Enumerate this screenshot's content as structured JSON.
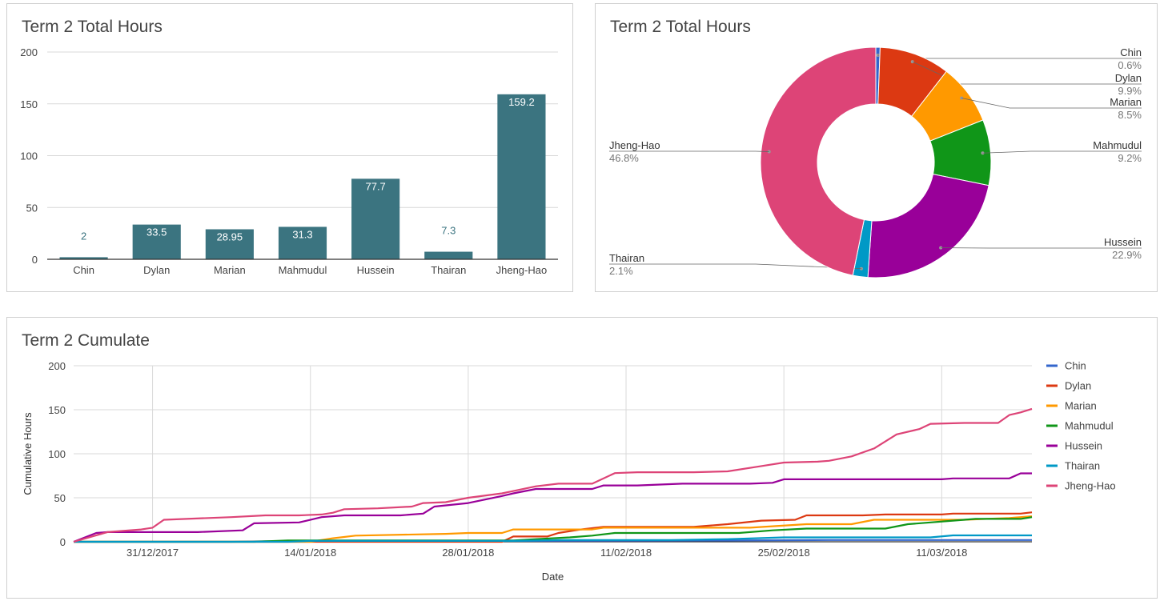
{
  "colors": {
    "bar": "#3b7480",
    "grid": "#d9d9d9",
    "axis": "#333333",
    "tick_text": "#444444",
    "pie_label": "#333333",
    "pie_pct": "#777777"
  },
  "bar_chart": {
    "title": "Term 2 Total Hours"
  },
  "pie_chart": {
    "title": "Term 2 Total Hours"
  },
  "line_chart": {
    "title": "Term 2 Cumulate"
  },
  "chart_data": [
    {
      "type": "bar",
      "title": "Term 2 Total Hours",
      "categories": [
        "Chin",
        "Dylan",
        "Marian",
        "Mahmudul",
        "Hussein",
        "Thairan",
        "Jheng-Hao"
      ],
      "values": [
        2,
        33.5,
        28.95,
        31.3,
        77.7,
        7.3,
        159.2
      ],
      "value_labels": [
        "2",
        "33.5",
        "28.95",
        "31.3",
        "77.7",
        "7.3",
        "159.2"
      ],
      "ylim": [
        0,
        200
      ],
      "yticks": [
        0,
        50,
        100,
        150,
        200
      ],
      "grid": true
    },
    {
      "type": "pie",
      "donut": true,
      "title": "Term 2 Total Hours",
      "slices": [
        {
          "label": "Chin",
          "percent": 0.6,
          "percent_text": "0.6%",
          "color": "#3366cc",
          "side": "right"
        },
        {
          "label": "Dylan",
          "percent": 9.9,
          "percent_text": "9.9%",
          "color": "#dc3912",
          "side": "right"
        },
        {
          "label": "Marian",
          "percent": 8.5,
          "percent_text": "8.5%",
          "color": "#ff9900",
          "side": "right"
        },
        {
          "label": "Mahmudul",
          "percent": 9.2,
          "percent_text": "9.2%",
          "color": "#109618",
          "side": "right"
        },
        {
          "label": "Hussein",
          "percent": 22.9,
          "percent_text": "22.9%",
          "color": "#990099",
          "side": "right"
        },
        {
          "label": "Thairan",
          "percent": 2.1,
          "percent_text": "2.1%",
          "color": "#0099c6",
          "side": "left"
        },
        {
          "label": "Jheng-Hao",
          "percent": 46.8,
          "percent_text": "46.8%",
          "color": "#dd4477",
          "side": "left"
        }
      ]
    },
    {
      "type": "line",
      "title": "Term 2 Cumulate",
      "xlabel": "Date",
      "ylabel": "Cumulative Hours",
      "x_start": "2017-12-24",
      "x_end": "2018-03-19",
      "x_ticks": [
        {
          "date": "2017-12-31",
          "label": "31/12/2017"
        },
        {
          "date": "2018-01-14",
          "label": "14/01/2018"
        },
        {
          "date": "2018-01-28",
          "label": "28/01/2018"
        },
        {
          "date": "2018-02-11",
          "label": "11/02/2018"
        },
        {
          "date": "2018-02-25",
          "label": "25/02/2018"
        },
        {
          "date": "2018-03-11",
          "label": "11/03/2018"
        }
      ],
      "ylim": [
        0,
        200
      ],
      "yticks": [
        0,
        50,
        100,
        150,
        200
      ],
      "grid": true,
      "legend_position": "right",
      "series": [
        {
          "name": "Chin",
          "color": "#3366cc",
          "points": [
            [
              "2017-12-24",
              0
            ],
            [
              "2018-01-07",
              0
            ],
            [
              "2018-01-10",
              0.5
            ],
            [
              "2018-02-01",
              1
            ],
            [
              "2018-02-20",
              1.5
            ],
            [
              "2018-03-01",
              2
            ],
            [
              "2018-03-19",
              2
            ]
          ]
        },
        {
          "name": "Dylan",
          "color": "#dc3912",
          "points": [
            [
              "2017-12-24",
              0
            ],
            [
              "2018-01-31",
              0
            ],
            [
              "2018-02-01",
              6
            ],
            [
              "2018-02-04",
              6
            ],
            [
              "2018-02-05",
              10
            ],
            [
              "2018-02-07",
              14
            ],
            [
              "2018-02-09",
              17
            ],
            [
              "2018-02-17",
              17
            ],
            [
              "2018-02-20",
              20
            ],
            [
              "2018-02-23",
              24
            ],
            [
              "2018-02-26",
              25
            ],
            [
              "2018-02-27",
              30
            ],
            [
              "2018-03-04",
              30
            ],
            [
              "2018-03-06",
              31
            ],
            [
              "2018-03-11",
              31
            ],
            [
              "2018-03-12",
              32
            ],
            [
              "2018-03-18",
              32
            ],
            [
              "2018-03-19",
              33.5
            ]
          ]
        },
        {
          "name": "Marian",
          "color": "#ff9900",
          "points": [
            [
              "2017-12-24",
              0
            ],
            [
              "2018-01-14",
              0
            ],
            [
              "2018-01-16",
              4
            ],
            [
              "2018-01-18",
              7
            ],
            [
              "2018-01-26",
              9
            ],
            [
              "2018-01-28",
              10
            ],
            [
              "2018-01-31",
              10
            ],
            [
              "2018-02-01",
              14
            ],
            [
              "2018-02-08",
              14
            ],
            [
              "2018-02-09",
              16
            ],
            [
              "2018-02-22",
              16
            ],
            [
              "2018-02-27",
              20
            ],
            [
              "2018-03-03",
              20
            ],
            [
              "2018-03-05",
              25
            ],
            [
              "2018-03-13",
              25
            ],
            [
              "2018-03-15",
              26
            ],
            [
              "2018-03-17",
              27
            ],
            [
              "2018-03-19",
              29
            ]
          ]
        },
        {
          "name": "Mahmudul",
          "color": "#109618",
          "points": [
            [
              "2017-12-24",
              0
            ],
            [
              "2018-01-09",
              0
            ],
            [
              "2018-01-12",
              1.5
            ],
            [
              "2018-02-01",
              1.5
            ],
            [
              "2018-02-03",
              3
            ],
            [
              "2018-02-06",
              5
            ],
            [
              "2018-02-08",
              7
            ],
            [
              "2018-02-10",
              10
            ],
            [
              "2018-02-21",
              10
            ],
            [
              "2018-02-24",
              13
            ],
            [
              "2018-02-27",
              15
            ],
            [
              "2018-03-06",
              15
            ],
            [
              "2018-03-08",
              20
            ],
            [
              "2018-03-10",
              22
            ],
            [
              "2018-03-12",
              24
            ],
            [
              "2018-03-14",
              26
            ],
            [
              "2018-03-18",
              26
            ],
            [
              "2018-03-19",
              28
            ]
          ]
        },
        {
          "name": "Hussein",
          "color": "#990099",
          "points": [
            [
              "2017-12-24",
              0
            ],
            [
              "2017-12-26",
              10
            ],
            [
              "2017-12-27",
              11
            ],
            [
              "2018-01-04",
              11
            ],
            [
              "2018-01-08",
              13
            ],
            [
              "2018-01-09",
              21
            ],
            [
              "2018-01-13",
              22
            ],
            [
              "2018-01-15",
              28
            ],
            [
              "2018-01-17",
              30
            ],
            [
              "2018-01-22",
              30
            ],
            [
              "2018-01-24",
              32
            ],
            [
              "2018-01-25",
              40
            ],
            [
              "2018-01-28",
              44
            ],
            [
              "2018-01-31",
              52
            ],
            [
              "2018-02-01",
              55
            ],
            [
              "2018-02-03",
              60
            ],
            [
              "2018-02-08",
              60
            ],
            [
              "2018-02-09",
              64
            ],
            [
              "2018-02-12",
              64
            ],
            [
              "2018-02-16",
              66
            ],
            [
              "2018-02-22",
              66
            ],
            [
              "2018-02-24",
              67
            ],
            [
              "2018-02-25",
              71
            ],
            [
              "2018-03-11",
              71
            ],
            [
              "2018-03-12",
              72
            ],
            [
              "2018-03-17",
              72
            ],
            [
              "2018-03-18",
              77.7
            ],
            [
              "2018-03-19",
              77.7
            ]
          ]
        },
        {
          "name": "Thairan",
          "color": "#0099c6",
          "points": [
            [
              "2017-12-24",
              0
            ],
            [
              "2018-01-12",
              0
            ],
            [
              "2018-01-14",
              1
            ],
            [
              "2018-02-01",
              1
            ],
            [
              "2018-02-05",
              2
            ],
            [
              "2018-02-15",
              2
            ],
            [
              "2018-02-20",
              3
            ],
            [
              "2018-02-25",
              5
            ],
            [
              "2018-03-10",
              5
            ],
            [
              "2018-03-12",
              7.3
            ],
            [
              "2018-03-19",
              7.3
            ]
          ]
        },
        {
          "name": "Jheng-Hao",
          "color": "#dd4477",
          "points": [
            [
              "2017-12-24",
              0
            ],
            [
              "2017-12-27",
              11
            ],
            [
              "2017-12-30",
              14
            ],
            [
              "2017-12-31",
              16
            ],
            [
              "2018-01-01",
              25
            ],
            [
              "2018-01-07",
              28
            ],
            [
              "2018-01-10",
              30
            ],
            [
              "2018-01-13",
              30
            ],
            [
              "2018-01-15",
              31
            ],
            [
              "2018-01-16",
              33
            ],
            [
              "2018-01-17",
              37
            ],
            [
              "2018-01-20",
              38
            ],
            [
              "2018-01-23",
              40
            ],
            [
              "2018-01-24",
              44
            ],
            [
              "2018-01-26",
              45
            ],
            [
              "2018-01-28",
              50
            ],
            [
              "2018-01-31",
              55
            ],
            [
              "2018-02-03",
              63
            ],
            [
              "2018-02-05",
              66
            ],
            [
              "2018-02-08",
              66
            ],
            [
              "2018-02-10",
              78
            ],
            [
              "2018-02-12",
              79
            ],
            [
              "2018-02-17",
              79
            ],
            [
              "2018-02-20",
              80
            ],
            [
              "2018-02-23",
              86
            ],
            [
              "2018-02-25",
              90
            ],
            [
              "2018-02-28",
              91
            ],
            [
              "2018-03-01",
              92
            ],
            [
              "2018-03-03",
              97
            ],
            [
              "2018-03-05",
              106
            ],
            [
              "2018-03-07",
              122
            ],
            [
              "2018-03-09",
              128
            ],
            [
              "2018-03-10",
              134
            ],
            [
              "2018-03-13",
              135
            ],
            [
              "2018-03-16",
              135
            ],
            [
              "2018-03-17",
              144
            ],
            [
              "2018-03-18",
              147
            ],
            [
              "2018-03-19",
              151
            ]
          ]
        }
      ]
    }
  ]
}
